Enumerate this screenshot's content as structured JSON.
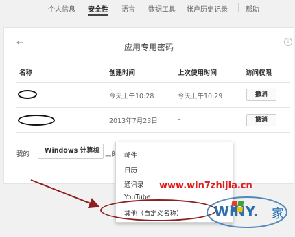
{
  "nav": {
    "tabs": [
      {
        "label": "个人信息"
      },
      {
        "label": "安全性"
      },
      {
        "label": "语言"
      },
      {
        "label": "数据工具"
      },
      {
        "label": "帐户历史记录"
      },
      {
        "label": "帮助"
      }
    ]
  },
  "card": {
    "title": "应用专用密码",
    "headers": {
      "name": "名称",
      "created": "创建时间",
      "last_used": "上次使用时间",
      "access": "访问权限"
    },
    "rows": [
      {
        "created": "今天上午10:28",
        "last_used": "今天上午10:29",
        "action": "撤消"
      },
      {
        "created": "2013年7月23日",
        "last_used": "–",
        "action": "撤消"
      }
    ],
    "bottom": {
      "prefix": "我的",
      "device_value": "Windows 计算机",
      "suffix": "上的"
    }
  },
  "dropdown": {
    "options": [
      "邮件",
      "日历",
      "通讯录",
      "YouTube",
      "其他（自定义名称）"
    ]
  },
  "watermark": {
    "url": "www.win7zhijia.cn"
  },
  "colors": {
    "annotation": "#8b2020",
    "watermark": "#e11c1c",
    "logo_blue": "#2a6fb0"
  }
}
